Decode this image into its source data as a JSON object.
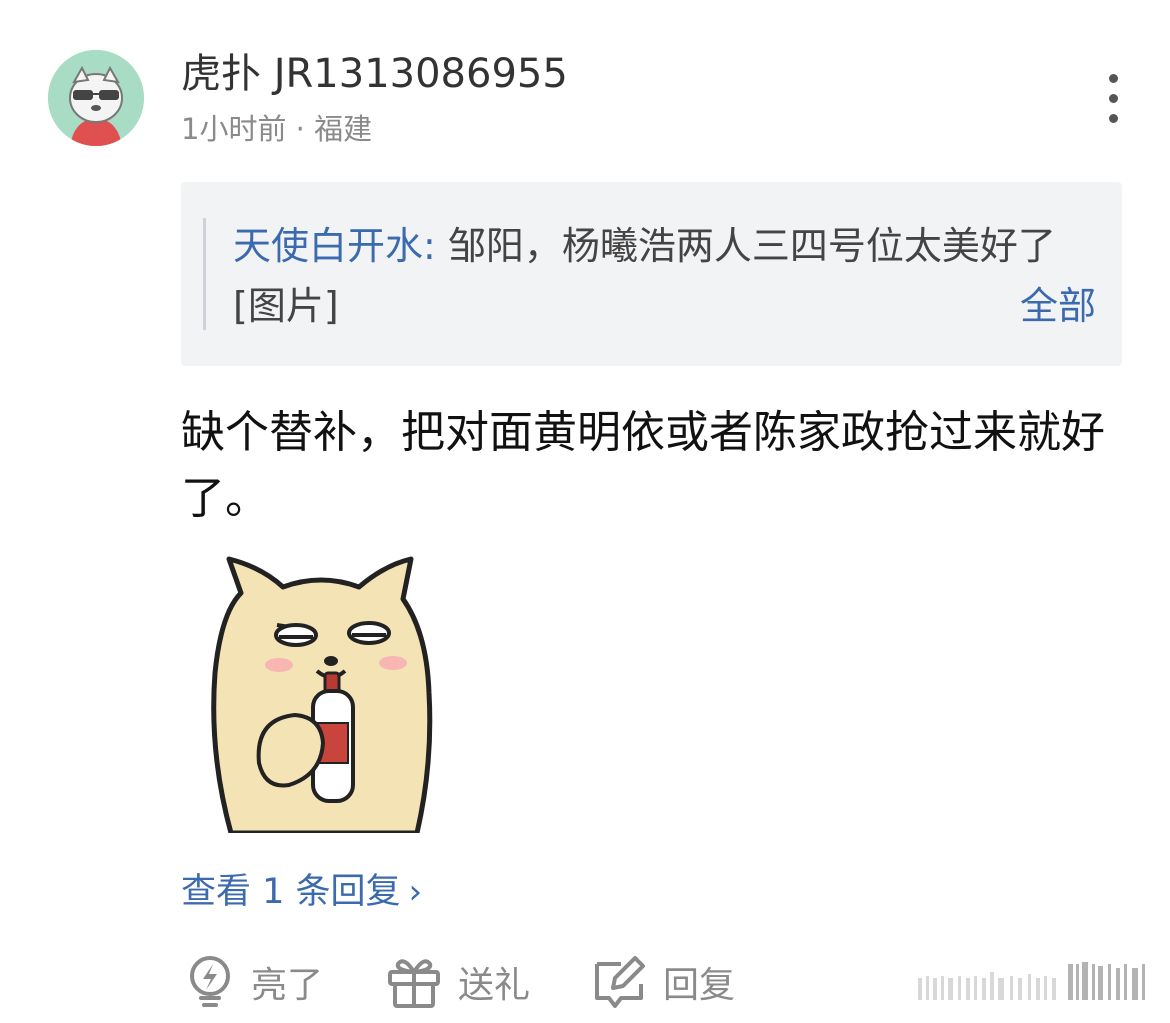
{
  "comment": {
    "username": "虎扑 JR1313086955",
    "time": "1小时前",
    "separator": "·",
    "location": "福建",
    "quote": {
      "author": "天使白开水:",
      "text": " 邹阳，杨曦浩两人三四号位太美好了[图片]",
      "expand_label": "全部"
    },
    "body": "缺个替补，把对面黄明依或者陈家政抢过来就好了。",
    "sticker_icon": "shiba-dog-drinking-sticker",
    "view_replies": {
      "label": "查看 1 条回复",
      "chevron": "›"
    },
    "actions": {
      "like": {
        "icon": "lightbulb-icon",
        "label": "亮了"
      },
      "gift": {
        "icon": "gift-icon",
        "label": "送礼"
      },
      "reply": {
        "icon": "reply-edit-icon",
        "label": "回复"
      }
    }
  },
  "colors": {
    "link": "#3b6aae",
    "muted": "#8a8a8a",
    "quote_bg": "#f2f3f5"
  }
}
